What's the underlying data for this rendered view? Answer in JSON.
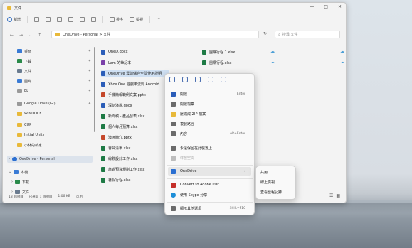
{
  "window": {
    "title": "文件",
    "controls": [
      "—",
      "□",
      "✕"
    ]
  },
  "toolbar": {
    "new_label": "新增",
    "sort_label": "排序",
    "view_label": "檢視",
    "more_label": "···"
  },
  "address": {
    "path": "OneDrive - Personal  >  文件",
    "search_placeholder": "搜尋 文件"
  },
  "sidebar": {
    "items": [
      {
        "label": "桌面",
        "color": "#3a7bd5"
      },
      {
        "label": "下載",
        "color": "#2a8a4a"
      },
      {
        "label": "文件",
        "color": "#6a7b8f"
      },
      {
        "label": "圖片",
        "color": "#3a7bd5"
      },
      {
        "label": "EL",
        "color": "#9a9a9a"
      },
      {
        "label": "Google Drive (G:)",
        "color": "#999"
      },
      {
        "label": "WINDOCF",
        "color": "#e8b93a"
      },
      {
        "label": "CUP",
        "color": "#e8b93a"
      },
      {
        "label": "Initial Unity",
        "color": "#e8b93a"
      },
      {
        "label": "小林的新家",
        "color": "#e8b93a"
      },
      {
        "label": "OneDrive - Personal",
        "color": "#2b6fd1"
      },
      {
        "label": "本機",
        "color": "#3a7bd5"
      },
      {
        "label": "下載",
        "color": "#2a8a4a"
      },
      {
        "label": "文件",
        "color": "#6a7b8f"
      }
    ]
  },
  "files": [
    {
      "name": "OneD.docx",
      "color": "#2b5db8"
    },
    {
      "name": "Lam 的筆記本",
      "color": "#7a3fa8"
    },
    {
      "name": "OneDrive 雲端儲存空間使用說明",
      "color": "#2b5db8"
    },
    {
      "name": "Xbox One 遊戲串流到 Android",
      "color": "#2b5db8"
    },
    {
      "name": "手機簡報範例文案.pptx",
      "color": "#c5472a"
    },
    {
      "name": "深刻演說.docx",
      "color": "#2b5db8"
    },
    {
      "name": "新聞稿 - 產品發表.xlsx",
      "color": "#1e7a45"
    },
    {
      "name": "個人每月預算.xlsx",
      "color": "#1e7a45"
    },
    {
      "name": "澳洲簡介.pptx",
      "color": "#c5472a"
    },
    {
      "name": "會員清單.xlsx",
      "color": "#1e7a45"
    },
    {
      "name": "線數設計工作.xlsx",
      "color": "#1e7a45"
    },
    {
      "name": "旅遊預算規劃工作.xlsx",
      "color": "#1e7a45"
    },
    {
      "name": "暑假行程.xlsx",
      "color": "#1e7a45"
    }
  ],
  "files_right": [
    {
      "name": "團購行程 1.xlsx",
      "color": "#1e7a45"
    },
    {
      "name": "團購行程.xlsx",
      "color": "#1e7a45"
    }
  ],
  "status": {
    "count": "13 個項目",
    "selected": "已選取 1 個項目",
    "size": "1.06 KB",
    "sync": "可用"
  },
  "context_menu": {
    "items": [
      {
        "label": "開啟",
        "shortcut": "Enter",
        "color": "#2b5db8"
      },
      {
        "label": "開啟檔案",
        "shortcut": "",
        "color": "#6b6b6b"
      },
      {
        "label": "壓縮成 ZIP 檔案",
        "shortcut": "",
        "color": "#e8b93a"
      },
      {
        "label": "複製路徑",
        "shortcut": "",
        "color": "#6b6b6b"
      },
      {
        "label": "內容",
        "shortcut": "Alt+Enter",
        "color": "#6b6b6b"
      },
      {
        "label": "永遠保留在此裝置上",
        "shortcut": "",
        "color": "#6b6b6b"
      },
      {
        "label": "釋放空間",
        "shortcut": "",
        "color": "#bdbdbd"
      },
      {
        "label": "OneDrive",
        "shortcut": "›",
        "color": "#2b6fd1"
      },
      {
        "label": "Convert to Adobe PDF",
        "shortcut": "",
        "color": "#c5302a"
      },
      {
        "label": "使用 Skype 分享",
        "shortcut": "",
        "color": "#1e8fd8"
      },
      {
        "label": "顯示其他選項",
        "shortcut": "Shift+F10",
        "color": "#6b6b6b"
      }
    ]
  },
  "submenu": {
    "items": [
      "共用",
      "線上檢視",
      "查看歷程記錄"
    ]
  }
}
